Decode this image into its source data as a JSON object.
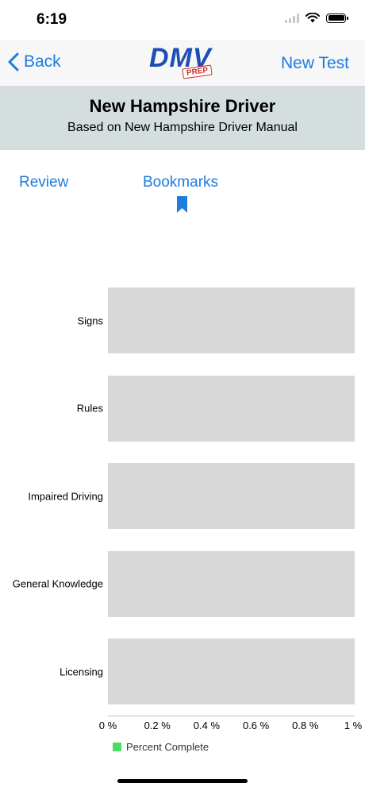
{
  "status_bar": {
    "time": "6:19"
  },
  "nav": {
    "back_label": "Back",
    "logo_text": "DMV",
    "logo_badge": "PREP",
    "new_test_label": "New Test"
  },
  "header": {
    "title": "New Hampshire Driver",
    "subtitle": "Based on New Hampshire Driver Manual"
  },
  "tabs": {
    "review": "Review",
    "bookmarks": "Bookmarks"
  },
  "colors": {
    "accent": "#1c7ce0",
    "legend": "#4cd964",
    "bar": "#d8d8d8",
    "header_band": "#d5dede"
  },
  "chart_data": {
    "type": "bar",
    "orientation": "horizontal",
    "categories": [
      "Signs",
      "Rules",
      "Impaired Driving",
      "General Knowledge",
      "Licensing"
    ],
    "series": [
      {
        "name": "Percent Complete",
        "values": [
          0,
          0,
          0,
          0,
          0
        ]
      }
    ],
    "xlim": [
      0,
      1
    ],
    "x_ticks": [
      "0 %",
      "0.2 %",
      "0.4 %",
      "0.6 %",
      "0.8 %",
      "1 %"
    ],
    "legend": {
      "label": "Percent Complete",
      "placement": "bottom-left"
    }
  }
}
